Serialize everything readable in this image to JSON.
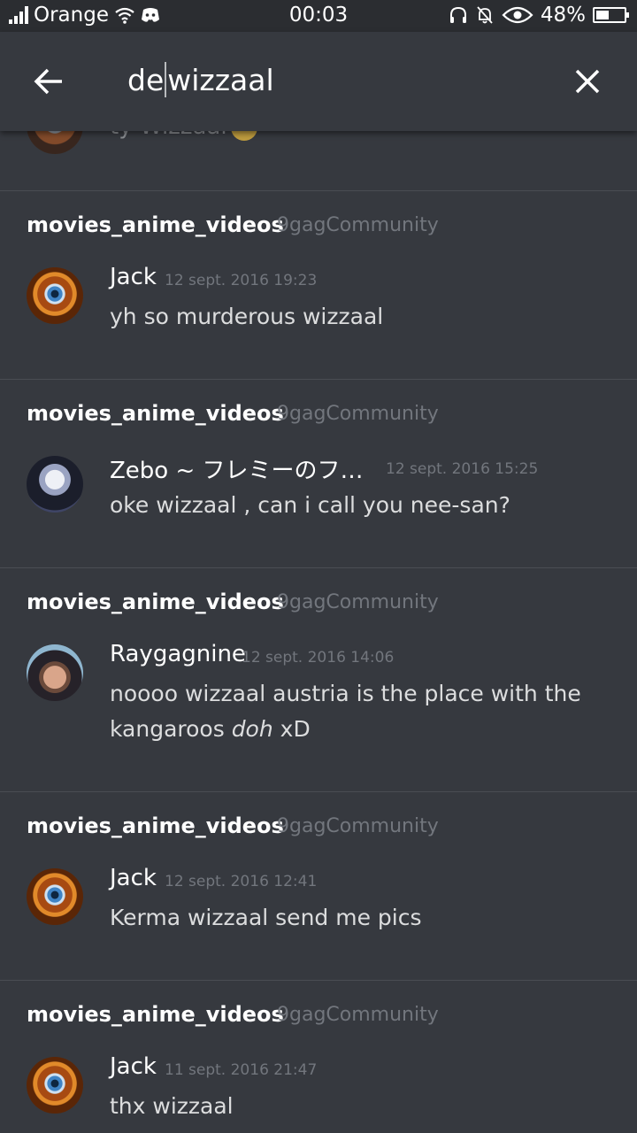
{
  "status_bar": {
    "carrier": "Orange",
    "time": "00:03",
    "battery": "48%",
    "battery_level": 0.48
  },
  "search": {
    "query_before_caret": "de",
    "query_after_caret": "wizzaal"
  },
  "partial_message": {
    "text": "ty Wizzaal"
  },
  "results": [
    {
      "channel": "movies_anime_videos",
      "guild": "9gagCommunity",
      "author": "Jack",
      "timestamp": "12 sept. 2016 19:23",
      "content": "yh so murderous wizzaal"
    },
    {
      "channel": "movies_anime_videos",
      "guild": "9gagCommunity",
      "author": "Zebo ~ フレミーのフ…",
      "timestamp": "12 sept. 2016 15:25",
      "content": "oke wizzaal , can i call you nee-san?"
    },
    {
      "channel": "movies_anime_videos",
      "guild": "9gagCommunity",
      "author": "Raygagnine",
      "timestamp": "12 sept. 2016 14:06",
      "content_a": "noooo wizzaal austria is the place with the kangaroos ",
      "content_em": "doh",
      "content_b": " xD"
    },
    {
      "channel": "movies_anime_videos",
      "guild": "9gagCommunity",
      "author": "Jack",
      "timestamp": "12 sept. 2016 12:41",
      "content": "Kerma wizzaal send me pics"
    },
    {
      "channel": "movies_anime_videos",
      "guild": "9gagCommunity",
      "author": "Jack",
      "timestamp": "11 sept. 2016 21:47",
      "content": "thx wizzaal"
    }
  ]
}
